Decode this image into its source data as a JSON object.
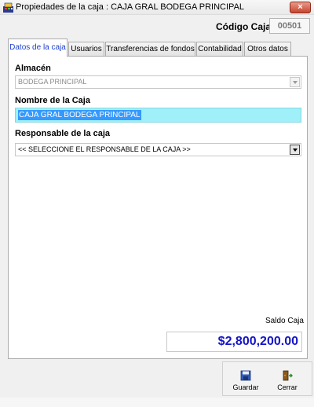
{
  "window": {
    "title": "Propiedades de la caja : CAJA GRAL BODEGA PRINCIPAL",
    "close_label": "×",
    "app_icon": "cash-register-icon"
  },
  "header": {
    "codigo_label": "Código Caja",
    "codigo_value": "00501"
  },
  "tabs": [
    {
      "label": "Datos de la caja",
      "active": true
    },
    {
      "label": "Usuarios",
      "active": false
    },
    {
      "label": "Transferencias de fondos",
      "active": false
    },
    {
      "label": "Contabilidad",
      "active": false
    },
    {
      "label": "Otros datos",
      "active": false
    }
  ],
  "form": {
    "almacen_label": "Almacén",
    "almacen_value": "BODEGA PRINCIPAL",
    "nombre_label": "Nombre de la Caja",
    "nombre_value": "CAJA GRAL BODEGA PRINCIPAL",
    "responsable_label": "Responsable de la caja",
    "responsable_value": "<< SELECCIONE EL RESPONSABLE DE LA CAJA >>",
    "saldo_label": "Saldo Caja",
    "saldo_value": "$2,800,200.00"
  },
  "toolbar": {
    "guardar_label": "Guardar",
    "cerrar_label": "Cerrar"
  },
  "colors": {
    "active_tab_text": "#1c3fce",
    "name_field_bg": "#9ff0f8",
    "selection_bg": "#3399ff",
    "saldo_text": "#1414c8"
  }
}
